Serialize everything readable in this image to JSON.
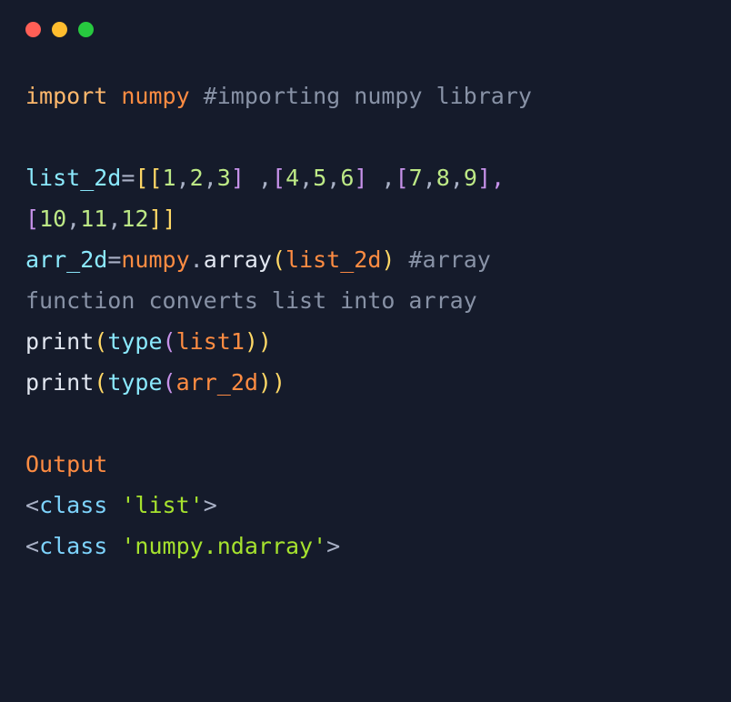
{
  "code": {
    "line1": {
      "import": "import",
      "module": "numpy",
      "comment": "#importing numpy library"
    },
    "line3": {
      "var": "list_2d",
      "eq": "=",
      "ob1": "[[",
      "n1": "1",
      "c": ",",
      "n2": "2",
      "n3": "3",
      "cb1": "]",
      "sp": " ,",
      "ob2": "[",
      "n4": "4",
      "n5": "5",
      "n6": "6",
      "n7": "7",
      "n8": "8",
      "n9": "9",
      "cb2": "],"
    },
    "line4": {
      "ob": "[",
      "n10": "10",
      "c": ",",
      "n11": "11",
      "n12": "12",
      "cb": "]]"
    },
    "line5": {
      "var": "arr_2d",
      "eq": "=",
      "module": "numpy",
      "dot": ".",
      "func": "array",
      "op": "(",
      "arg": "list_2d",
      "cp": ")",
      "comment": " #array"
    },
    "line6": {
      "comment": "function converts list into array"
    },
    "line7": {
      "func": "print",
      "op": "(",
      "type": "type",
      "op2": "(",
      "arg": "list1",
      "cp": "))"
    },
    "line8": {
      "func": "print",
      "op": "(",
      "type": "type",
      "op2": "(",
      "arg": "arr_2d",
      "cp": "))"
    },
    "output": {
      "label": "Output",
      "l1_lt": "<",
      "l1_class": "class ",
      "l1_str": "'list'",
      "l1_gt": ">",
      "l2_lt": "<",
      "l2_class": "class ",
      "l2_str": "'numpy.ndarray'",
      "l2_gt": ">"
    }
  }
}
